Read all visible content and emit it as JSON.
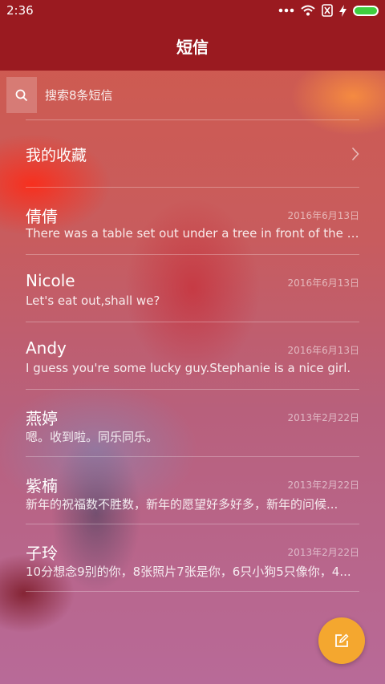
{
  "status_bar": {
    "time": "2:36",
    "icons": [
      "dots-icon",
      "wifi-icon",
      "no-sim-icon",
      "charging-icon",
      "battery-icon"
    ]
  },
  "header": {
    "title": "短信"
  },
  "search": {
    "placeholder": "搜索8条短信"
  },
  "favorites": {
    "label": "我的收藏"
  },
  "conversations": [
    {
      "name": "倩倩",
      "date": "2016年6月13日",
      "preview": "There was a table set out under a tree in front of the ho..."
    },
    {
      "name": "Nicole",
      "date": "2016年6月13日",
      "preview": "Let's eat out,shall we?"
    },
    {
      "name": "Andy",
      "date": "2016年6月13日",
      "preview": "I guess you're some lucky guy.Stephanie is a nice girl."
    },
    {
      "name": "燕婷",
      "date": "2013年2月22日",
      "preview": "嗯。收到啦。同乐同乐。"
    },
    {
      "name": "紫楠",
      "date": "2013年2月22日",
      "preview": "新年的祝福数不胜数，新年的愿望好多好多，新年的问候..."
    },
    {
      "name": "子玲",
      "date": "2013年2月22日",
      "preview": "10分想念9别的你，8张照片7张是你，6只小狗5只像你，4..."
    }
  ],
  "fab": {
    "icon": "compose-icon",
    "color": "#f4a72f"
  },
  "colors": {
    "bar": "#9a1a20",
    "accent": "#f4a72f",
    "battery": "#3fcf3f"
  }
}
